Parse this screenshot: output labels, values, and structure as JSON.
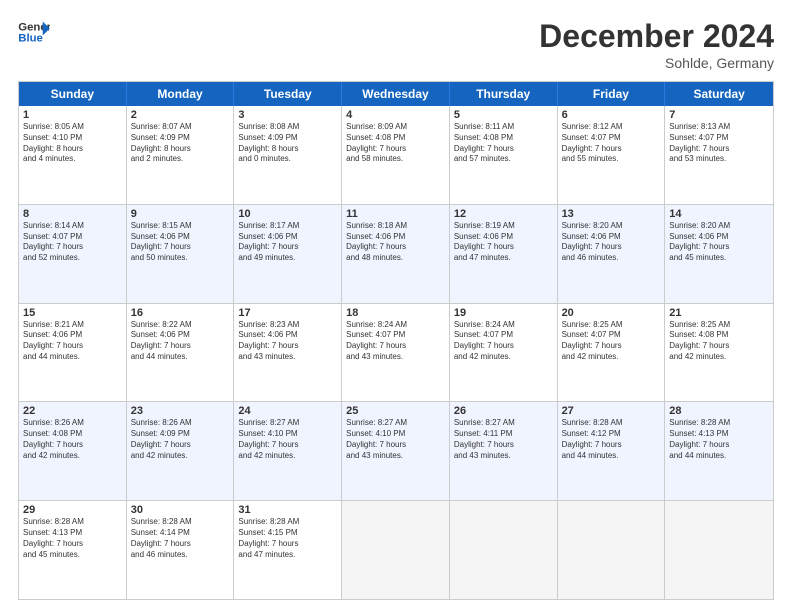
{
  "logo": {
    "line1": "General",
    "line2": "Blue"
  },
  "title": "December 2024",
  "subtitle": "Sohlde, Germany",
  "header_days": [
    "Sunday",
    "Monday",
    "Tuesday",
    "Wednesday",
    "Thursday",
    "Friday",
    "Saturday"
  ],
  "weeks": [
    [
      {
        "day": "1",
        "lines": [
          "Sunrise: 8:05 AM",
          "Sunset: 4:10 PM",
          "Daylight: 8 hours",
          "and 4 minutes."
        ]
      },
      {
        "day": "2",
        "lines": [
          "Sunrise: 8:07 AM",
          "Sunset: 4:09 PM",
          "Daylight: 8 hours",
          "and 2 minutes."
        ]
      },
      {
        "day": "3",
        "lines": [
          "Sunrise: 8:08 AM",
          "Sunset: 4:09 PM",
          "Daylight: 8 hours",
          "and 0 minutes."
        ]
      },
      {
        "day": "4",
        "lines": [
          "Sunrise: 8:09 AM",
          "Sunset: 4:08 PM",
          "Daylight: 7 hours",
          "and 58 minutes."
        ]
      },
      {
        "day": "5",
        "lines": [
          "Sunrise: 8:11 AM",
          "Sunset: 4:08 PM",
          "Daylight: 7 hours",
          "and 57 minutes."
        ]
      },
      {
        "day": "6",
        "lines": [
          "Sunrise: 8:12 AM",
          "Sunset: 4:07 PM",
          "Daylight: 7 hours",
          "and 55 minutes."
        ]
      },
      {
        "day": "7",
        "lines": [
          "Sunrise: 8:13 AM",
          "Sunset: 4:07 PM",
          "Daylight: 7 hours",
          "and 53 minutes."
        ]
      }
    ],
    [
      {
        "day": "8",
        "lines": [
          "Sunrise: 8:14 AM",
          "Sunset: 4:07 PM",
          "Daylight: 7 hours",
          "and 52 minutes."
        ]
      },
      {
        "day": "9",
        "lines": [
          "Sunrise: 8:15 AM",
          "Sunset: 4:06 PM",
          "Daylight: 7 hours",
          "and 50 minutes."
        ]
      },
      {
        "day": "10",
        "lines": [
          "Sunrise: 8:17 AM",
          "Sunset: 4:06 PM",
          "Daylight: 7 hours",
          "and 49 minutes."
        ]
      },
      {
        "day": "11",
        "lines": [
          "Sunrise: 8:18 AM",
          "Sunset: 4:06 PM",
          "Daylight: 7 hours",
          "and 48 minutes."
        ]
      },
      {
        "day": "12",
        "lines": [
          "Sunrise: 8:19 AM",
          "Sunset: 4:06 PM",
          "Daylight: 7 hours",
          "and 47 minutes."
        ]
      },
      {
        "day": "13",
        "lines": [
          "Sunrise: 8:20 AM",
          "Sunset: 4:06 PM",
          "Daylight: 7 hours",
          "and 46 minutes."
        ]
      },
      {
        "day": "14",
        "lines": [
          "Sunrise: 8:20 AM",
          "Sunset: 4:06 PM",
          "Daylight: 7 hours",
          "and 45 minutes."
        ]
      }
    ],
    [
      {
        "day": "15",
        "lines": [
          "Sunrise: 8:21 AM",
          "Sunset: 4:06 PM",
          "Daylight: 7 hours",
          "and 44 minutes."
        ]
      },
      {
        "day": "16",
        "lines": [
          "Sunrise: 8:22 AM",
          "Sunset: 4:06 PM",
          "Daylight: 7 hours",
          "and 44 minutes."
        ]
      },
      {
        "day": "17",
        "lines": [
          "Sunrise: 8:23 AM",
          "Sunset: 4:06 PM",
          "Daylight: 7 hours",
          "and 43 minutes."
        ]
      },
      {
        "day": "18",
        "lines": [
          "Sunrise: 8:24 AM",
          "Sunset: 4:07 PM",
          "Daylight: 7 hours",
          "and 43 minutes."
        ]
      },
      {
        "day": "19",
        "lines": [
          "Sunrise: 8:24 AM",
          "Sunset: 4:07 PM",
          "Daylight: 7 hours",
          "and 42 minutes."
        ]
      },
      {
        "day": "20",
        "lines": [
          "Sunrise: 8:25 AM",
          "Sunset: 4:07 PM",
          "Daylight: 7 hours",
          "and 42 minutes."
        ]
      },
      {
        "day": "21",
        "lines": [
          "Sunrise: 8:25 AM",
          "Sunset: 4:08 PM",
          "Daylight: 7 hours",
          "and 42 minutes."
        ]
      }
    ],
    [
      {
        "day": "22",
        "lines": [
          "Sunrise: 8:26 AM",
          "Sunset: 4:08 PM",
          "Daylight: 7 hours",
          "and 42 minutes."
        ]
      },
      {
        "day": "23",
        "lines": [
          "Sunrise: 8:26 AM",
          "Sunset: 4:09 PM",
          "Daylight: 7 hours",
          "and 42 minutes."
        ]
      },
      {
        "day": "24",
        "lines": [
          "Sunrise: 8:27 AM",
          "Sunset: 4:10 PM",
          "Daylight: 7 hours",
          "and 42 minutes."
        ]
      },
      {
        "day": "25",
        "lines": [
          "Sunrise: 8:27 AM",
          "Sunset: 4:10 PM",
          "Daylight: 7 hours",
          "and 43 minutes."
        ]
      },
      {
        "day": "26",
        "lines": [
          "Sunrise: 8:27 AM",
          "Sunset: 4:11 PM",
          "Daylight: 7 hours",
          "and 43 minutes."
        ]
      },
      {
        "day": "27",
        "lines": [
          "Sunrise: 8:28 AM",
          "Sunset: 4:12 PM",
          "Daylight: 7 hours",
          "and 44 minutes."
        ]
      },
      {
        "day": "28",
        "lines": [
          "Sunrise: 8:28 AM",
          "Sunset: 4:13 PM",
          "Daylight: 7 hours",
          "and 44 minutes."
        ]
      }
    ],
    [
      {
        "day": "29",
        "lines": [
          "Sunrise: 8:28 AM",
          "Sunset: 4:13 PM",
          "Daylight: 7 hours",
          "and 45 minutes."
        ]
      },
      {
        "day": "30",
        "lines": [
          "Sunrise: 8:28 AM",
          "Sunset: 4:14 PM",
          "Daylight: 7 hours",
          "and 46 minutes."
        ]
      },
      {
        "day": "31",
        "lines": [
          "Sunrise: 8:28 AM",
          "Sunset: 4:15 PM",
          "Daylight: 7 hours",
          "and 47 minutes."
        ]
      },
      null,
      null,
      null,
      null
    ]
  ]
}
